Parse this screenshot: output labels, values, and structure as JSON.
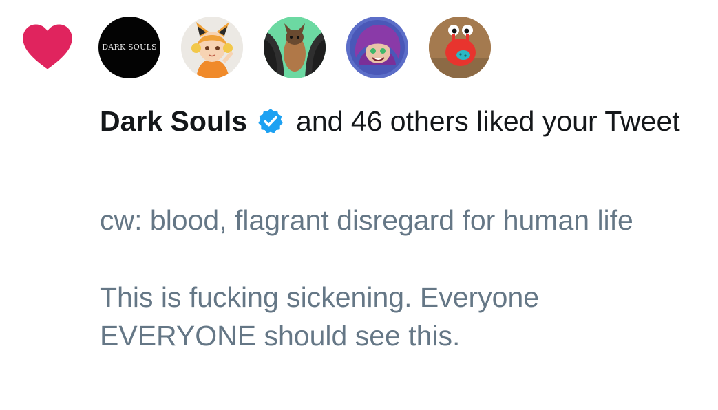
{
  "notification": {
    "type_icon": "heart-icon",
    "accent_color": "#e0245e",
    "avatars": [
      {
        "name": "dark-souls-avatar",
        "text": "DARK SOULS"
      },
      {
        "name": "anime-fox-girl-avatar"
      },
      {
        "name": "bat-avatar"
      },
      {
        "name": "purple-hair-character-avatar"
      },
      {
        "name": "red-creature-avatar"
      }
    ],
    "headline": {
      "user": "Dark Souls",
      "verified_icon": "verified-badge-icon",
      "verified_color": "#1da1f2",
      "rest": "and 46 others liked your Tweet"
    },
    "tweet": {
      "line1": "cw: blood, flagrant disregard for human life",
      "line2": "This is fucking sickening. Everyone EVERYONE should see this."
    }
  }
}
